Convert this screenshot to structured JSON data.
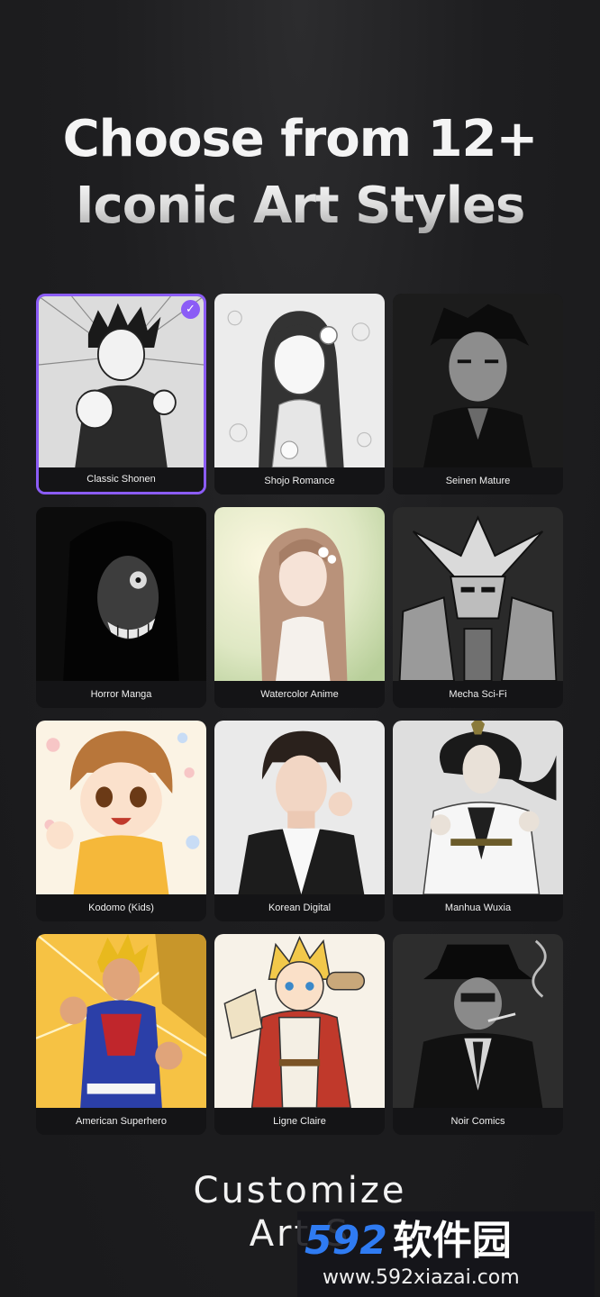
{
  "header": {
    "title_line1": "Choose from 12+",
    "title_line2": "Iconic Art Styles"
  },
  "styles": [
    {
      "label": "Classic Shonen",
      "selected": true,
      "palette": "bw"
    },
    {
      "label": "Shojo Romance",
      "selected": false,
      "palette": "light-bw"
    },
    {
      "label": "Seinen Mature",
      "selected": false,
      "palette": "dark-bw"
    },
    {
      "label": "Horror Manga",
      "selected": false,
      "palette": "dark"
    },
    {
      "label": "Watercolor Anime",
      "selected": false,
      "palette": "pastel"
    },
    {
      "label": "Mecha Sci-Fi",
      "selected": false,
      "palette": "bw"
    },
    {
      "label": "Kodomo (Kids)",
      "selected": false,
      "palette": "warm"
    },
    {
      "label": "Korean Digital",
      "selected": false,
      "palette": "neutral"
    },
    {
      "label": "Manhua Wuxia",
      "selected": false,
      "palette": "light-ink"
    },
    {
      "label": "American Superhero",
      "selected": false,
      "palette": "vivid"
    },
    {
      "label": "Ligne Claire",
      "selected": false,
      "palette": "bright"
    },
    {
      "label": "Noir Comics",
      "selected": false,
      "palette": "noir"
    }
  ],
  "selected_check_icon": "✓",
  "footer": {
    "title_line1": "Customize",
    "title_line2": "Art S"
  },
  "watermark": {
    "brand_number": "592",
    "brand_text": "软件园",
    "url": "www.592xiazai.com"
  },
  "colors": {
    "accent": "#8b5cf6",
    "background": "#1e1e20",
    "label_bar": "#141416"
  }
}
